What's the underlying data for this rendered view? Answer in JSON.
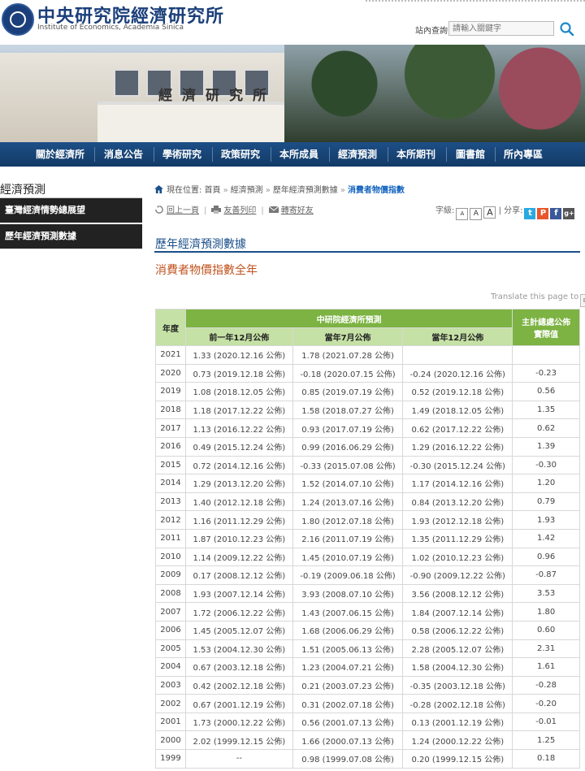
{
  "header": {
    "title": "中央研究院經濟研究所",
    "subtitle": "Institute of Economics, Academia Sinica",
    "search_label": "站內查詢:",
    "search_placeholder": "請輸入關鍵字"
  },
  "banner": {
    "sign": "經濟研究所"
  },
  "nav": [
    "關於經濟所",
    "消息公告",
    "學術研究",
    "政策研究",
    "本所成員",
    "經濟預測",
    "本所期刊",
    "圖書館",
    "所內專區"
  ],
  "sidebar": {
    "title": "經濟預測",
    "items": [
      "臺灣經濟情勢總展望",
      "歷年經濟預測數據"
    ]
  },
  "breadcrumb": {
    "prefix": "現在位置:",
    "items": [
      "首頁",
      "經濟預測",
      "歷年經濟預測數據"
    ],
    "current": "消費者物價指數"
  },
  "tools": {
    "back": "回上一頁",
    "print": "友善列印",
    "mail": "轉寄好友",
    "font_label": "字級:",
    "share_label": "| 分享:",
    "font_sizes": [
      "A",
      "A",
      "A"
    ]
  },
  "section_title": "歷年經濟預測數據",
  "sub_title": "消費者物價指數全年",
  "translate": {
    "label": "Translate this page to",
    "icon": "En"
  },
  "table": {
    "year_header": "年度",
    "group_header": "中研院經濟所預測",
    "actual_header_1": "主計總處公佈",
    "actual_header_2": "實際值",
    "sub_headers": [
      "前一年12月公佈",
      "當年7月公佈",
      "當年12月公佈"
    ],
    "rows": [
      {
        "year": "2021",
        "prev_dec": "1.33 (2020.12.16 公佈)",
        "jul": "1.78 (2021.07.28 公佈)",
        "dec": "",
        "actual": ""
      },
      {
        "year": "2020",
        "prev_dec": "0.73 (2019.12.18 公佈)",
        "jul": "-0.18 (2020.07.15 公佈)",
        "dec": "-0.24 (2020.12.16 公佈)",
        "actual": "-0.23"
      },
      {
        "year": "2019",
        "prev_dec": "1.08 (2018.12.05 公佈)",
        "jul": "0.85 (2019.07.19 公佈)",
        "dec": "0.52 (2019.12.18 公佈)",
        "actual": "0.56"
      },
      {
        "year": "2018",
        "prev_dec": "1.18 (2017.12.22 公佈)",
        "jul": "1.58 (2018.07.27 公佈)",
        "dec": "1.49 (2018.12.05 公佈)",
        "actual": "1.35"
      },
      {
        "year": "2017",
        "prev_dec": "1.13 (2016.12.22 公佈)",
        "jul": "0.93 (2017.07.19 公佈)",
        "dec": "0.62 (2017.12.22 公佈)",
        "actual": "0.62"
      },
      {
        "year": "2016",
        "prev_dec": "0.49 (2015.12.24 公佈)",
        "jul": "0.99 (2016.06.29 公佈)",
        "dec": "1.29 (2016.12.22 公佈)",
        "actual": "1.39"
      },
      {
        "year": "2015",
        "prev_dec": "0.72 (2014.12.16 公佈)",
        "jul": "-0.33 (2015.07.08 公佈)",
        "dec": "-0.30 (2015.12.24 公佈)",
        "actual": "-0.30"
      },
      {
        "year": "2014",
        "prev_dec": "1.29 (2013.12.20 公佈)",
        "jul": "1.52 (2014.07.10 公佈)",
        "dec": "1.17 (2014.12.16 公佈)",
        "actual": "1.20"
      },
      {
        "year": "2013",
        "prev_dec": "1.40 (2012.12.18 公佈)",
        "jul": "1.24 (2013.07.16 公佈)",
        "dec": "0.84 (2013.12.20 公佈)",
        "actual": "0.79"
      },
      {
        "year": "2012",
        "prev_dec": "1.16 (2011.12.29 公佈)",
        "jul": "1.80 (2012.07.18 公佈)",
        "dec": "1.93 (2012.12.18 公佈)",
        "actual": "1.93"
      },
      {
        "year": "2011",
        "prev_dec": "1.87 (2010.12.23 公佈)",
        "jul": "2.16 (2011.07.19 公佈)",
        "dec": "1.35 (2011.12.29 公佈)",
        "actual": "1.42"
      },
      {
        "year": "2010",
        "prev_dec": "1.14 (2009.12.22 公佈)",
        "jul": "1.45 (2010.07.19 公佈)",
        "dec": "1.02 (2010.12.23 公佈)",
        "actual": "0.96"
      },
      {
        "year": "2009",
        "prev_dec": "0.17 (2008.12.12 公佈)",
        "jul": "-0.19 (2009.06.18 公佈)",
        "dec": "-0.90 (2009.12.22 公佈)",
        "actual": "-0.87"
      },
      {
        "year": "2008",
        "prev_dec": "1.93 (2007.12.14 公佈)",
        "jul": "3.93 (2008.07.10 公佈)",
        "dec": "3.56 (2008.12.12 公佈)",
        "actual": "3.53"
      },
      {
        "year": "2007",
        "prev_dec": "1.72 (2006.12.22 公佈)",
        "jul": "1.43 (2007.06.15 公佈)",
        "dec": "1.84 (2007.12.14 公佈)",
        "actual": "1.80"
      },
      {
        "year": "2006",
        "prev_dec": "1.45 (2005.12.07 公佈)",
        "jul": "1.68 (2006.06.29 公佈)",
        "dec": "0.58 (2006.12.22 公佈)",
        "actual": "0.60"
      },
      {
        "year": "2005",
        "prev_dec": "1.53 (2004.12.30 公佈)",
        "jul": "1.51 (2005.06.13 公佈)",
        "dec": "2.28 (2005.12.07 公佈)",
        "actual": "2.31"
      },
      {
        "year": "2004",
        "prev_dec": "0.67 (2003.12.18 公佈)",
        "jul": "1.23 (2004.07.21 公佈)",
        "dec": "1.58 (2004.12.30 公佈)",
        "actual": "1.61"
      },
      {
        "year": "2003",
        "prev_dec": "0.42 (2002.12.18 公佈)",
        "jul": "0.21 (2003.07.23 公佈)",
        "dec": "-0.35 (2003.12.18 公佈)",
        "actual": "-0.28"
      },
      {
        "year": "2002",
        "prev_dec": "0.67 (2001.12.19 公佈)",
        "jul": "0.31 (2002.07.18 公佈)",
        "dec": "-0.28 (2002.12.18 公佈)",
        "actual": "-0.20"
      },
      {
        "year": "2001",
        "prev_dec": "1.73 (2000.12.22 公佈)",
        "jul": "0.56 (2001.07.13 公佈)",
        "dec": "0.13 (2001.12.19 公佈)",
        "actual": "-0.01"
      },
      {
        "year": "2000",
        "prev_dec": "2.02 (1999.12.15 公佈)",
        "jul": "1.66 (2000.07.13 公佈)",
        "dec": "1.24 (2000.12.22 公佈)",
        "actual": "1.25"
      },
      {
        "year": "1999",
        "prev_dec": "--",
        "jul": "0.98 (1999.07.08 公佈)",
        "dec": "0.20 (1999.12.15 公佈)",
        "actual": "0.18"
      }
    ]
  },
  "colors": {
    "nav_bg": "#1a4f8a",
    "table_header_dark": "#7cb342",
    "table_header_light": "#c5e1a5",
    "sub_title": "#c0531e",
    "breadcrumb_current": "#1565c0"
  }
}
